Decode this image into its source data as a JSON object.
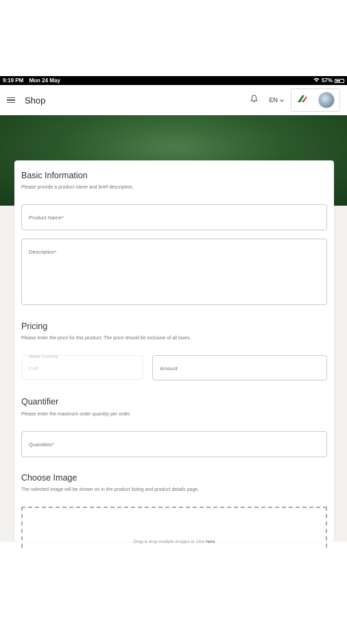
{
  "status_bar": {
    "time": "9:19 PM",
    "date": "Mon 24 May",
    "battery": "57%",
    "battery_level": 0.57
  },
  "header": {
    "title": "Shop",
    "language": "EN",
    "icons": [
      "menu-icon",
      "bell-icon",
      "chevron-down-icon",
      "brand-logo",
      "avatar"
    ]
  },
  "form": {
    "basic": {
      "title": "Basic Information",
      "desc": "Please provide a product name and brief description.",
      "product_name_label": "Product Name*",
      "description_label": "Description*"
    },
    "pricing": {
      "title": "Pricing",
      "desc": "Please enter the price for this product. The price should be inclusive of all taxes.",
      "currency_label": "Select Currency",
      "currency_value": "CHF",
      "amount_label": "Amount"
    },
    "quantifier": {
      "title": "Quantifier",
      "desc": "Please enter the maximum order quantity per order.",
      "quantities_label": "Quantities*"
    },
    "image": {
      "title": "Choose Image",
      "desc": "The selected image will be shown on in the product listing and product details page.",
      "drop_text": "Drag & drop multiple images or click ",
      "drop_link": "here"
    }
  },
  "colors": {
    "banner": "#2c5a2c",
    "background": "#f2f1ef",
    "border": "#cccccc"
  }
}
